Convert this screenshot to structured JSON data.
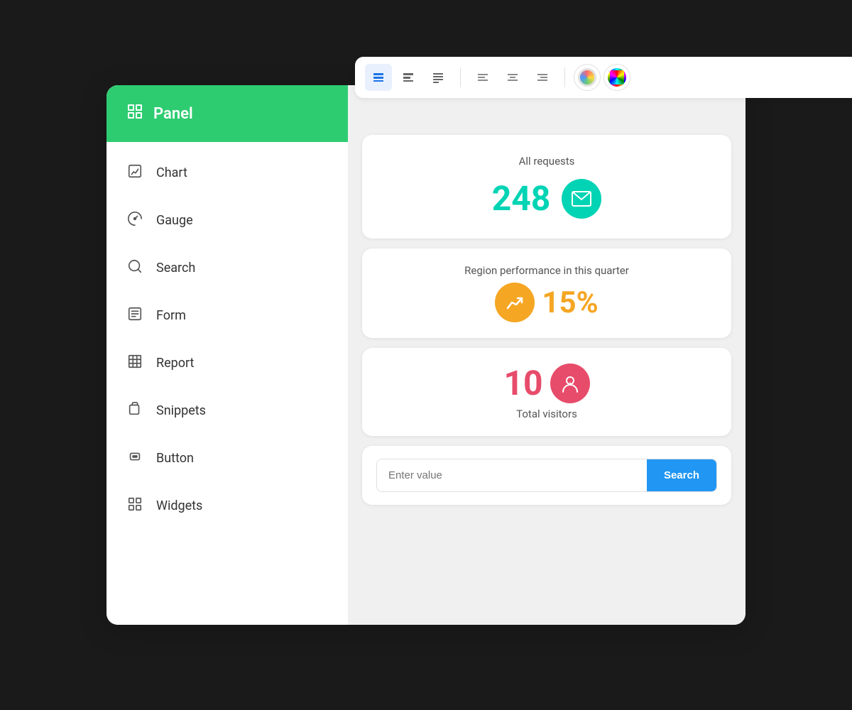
{
  "sidebar": {
    "header": {
      "title": "Panel",
      "icon": "panel-icon"
    },
    "items": [
      {
        "label": "Chart",
        "icon": "chart-icon",
        "id": "chart"
      },
      {
        "label": "Gauge",
        "icon": "gauge-icon",
        "id": "gauge"
      },
      {
        "label": "Search",
        "icon": "search-icon",
        "id": "search"
      },
      {
        "label": "Form",
        "icon": "form-icon",
        "id": "form"
      },
      {
        "label": "Report",
        "icon": "report-icon",
        "id": "report"
      },
      {
        "label": "Snippets",
        "icon": "snippets-icon",
        "id": "snippets"
      },
      {
        "label": "Button",
        "icon": "button-icon",
        "id": "button"
      },
      {
        "label": "Widgets",
        "icon": "widgets-icon",
        "id": "widgets"
      }
    ]
  },
  "toolbar": {
    "buttons": [
      {
        "id": "layout1",
        "active": true
      },
      {
        "id": "layout2",
        "active": false
      },
      {
        "id": "layout3",
        "active": false
      },
      {
        "id": "align-left",
        "active": false
      },
      {
        "id": "align-center",
        "active": false
      },
      {
        "id": "align-right",
        "active": false
      }
    ]
  },
  "cards": {
    "requests": {
      "label": "All requests",
      "value": "248",
      "icon": "envelope-icon"
    },
    "region": {
      "label": "Region performance in this quarter",
      "value": "15%",
      "icon": "chart-up-icon"
    },
    "visitors": {
      "value": "10",
      "label": "Total visitors",
      "icon": "user-star-icon"
    },
    "search": {
      "placeholder": "Enter value",
      "button_label": "Search"
    }
  }
}
